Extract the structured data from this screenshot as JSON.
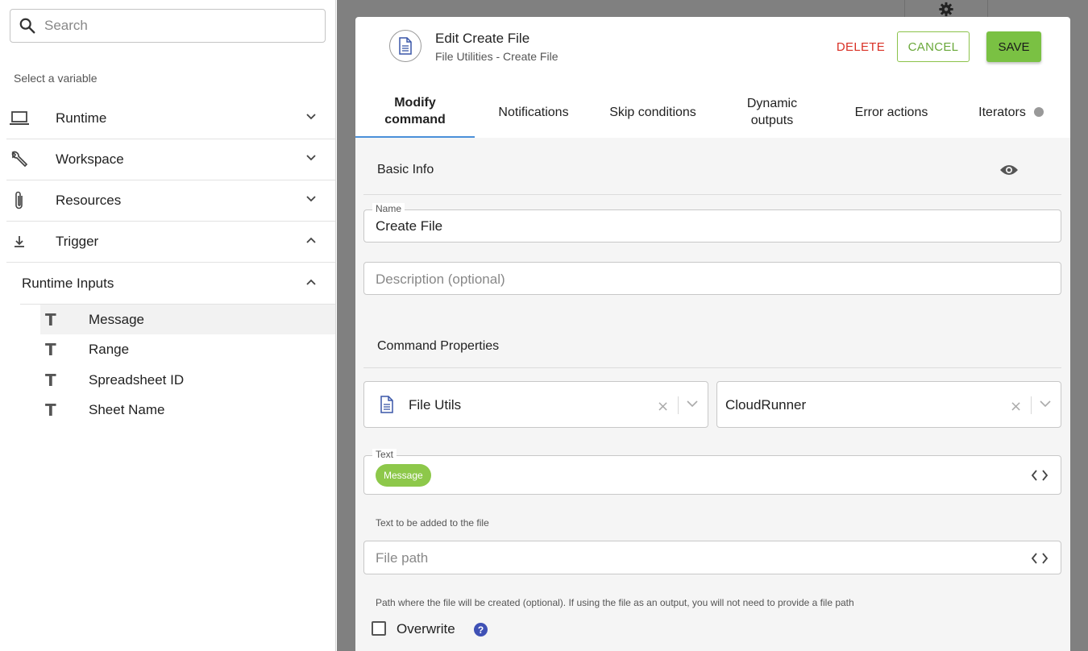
{
  "sidebar": {
    "search_placeholder": "Search",
    "select_label": "Select a variable",
    "groups": [
      {
        "label": "Runtime",
        "icon": "laptop-icon",
        "expanded": false
      },
      {
        "label": "Workspace",
        "icon": "wrench-icon",
        "expanded": false
      },
      {
        "label": "Resources",
        "icon": "paperclip-icon",
        "expanded": false
      },
      {
        "label": "Trigger",
        "icon": "download-arrow-icon",
        "expanded": true
      }
    ],
    "subgroup": {
      "label": "Runtime Inputs",
      "expanded": true
    },
    "variables": [
      {
        "label": "Message",
        "type_icon": "text-type-icon",
        "selected": true
      },
      {
        "label": "Range",
        "type_icon": "text-type-icon",
        "selected": false
      },
      {
        "label": "Spreadsheet ID",
        "type_icon": "text-type-icon",
        "selected": false
      },
      {
        "label": "Sheet Name",
        "type_icon": "text-type-icon",
        "selected": false
      }
    ]
  },
  "modal": {
    "title": "Edit Create File",
    "subtitle": "File Utilities - Create File",
    "buttons": {
      "delete": "DELETE",
      "cancel": "CANCEL",
      "save": "SAVE"
    },
    "tabs": [
      {
        "line1": "Modify",
        "line2": "command",
        "active": true
      },
      {
        "line1": "Notifications",
        "line2": "",
        "active": false
      },
      {
        "line1": "Skip conditions",
        "line2": "",
        "active": false
      },
      {
        "line1": "Dynamic",
        "line2": "outputs",
        "active": false
      },
      {
        "line1": "Error actions",
        "line2": "",
        "active": false
      },
      {
        "line1": "Iterators",
        "line2": "",
        "active": false
      }
    ],
    "basic_info": {
      "title": "Basic Info",
      "name_label": "Name",
      "name_value": "Create File",
      "description_placeholder": "Description (optional)"
    },
    "command_properties": {
      "title": "Command Properties",
      "integration_value": "File Utils",
      "runner_value": "CloudRunner",
      "text_label": "Text",
      "text_chip": "Message",
      "text_helper": "Text to be added to the file",
      "filepath_placeholder": "File path",
      "filepath_helper": "Path where the file will be created (optional). If using the file as an output, you will not need to provide a file path",
      "overwrite_label": "Overwrite",
      "help_glyph": "?"
    }
  },
  "colors": {
    "accent_green": "#7ac143",
    "delete_red": "#d93025",
    "tab_underline": "#4a90d9",
    "help_blue": "#3f51b5",
    "backdrop": "#808080"
  }
}
